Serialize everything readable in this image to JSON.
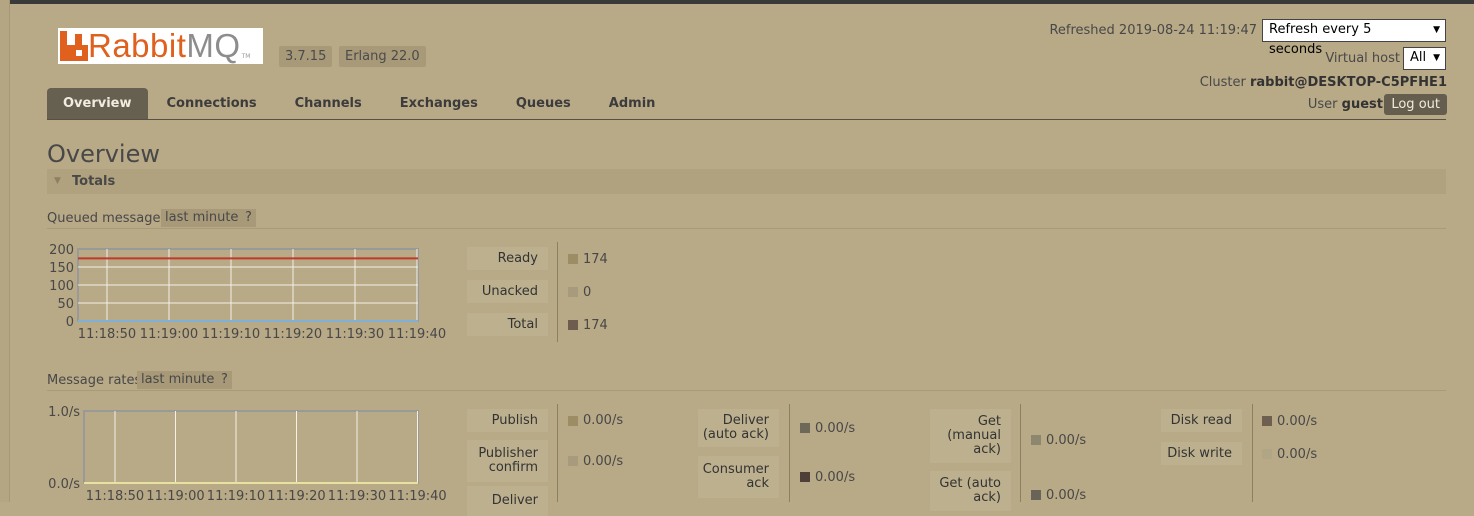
{
  "app": {
    "logo": {
      "brand_r": "Rabbit",
      "brand_m": "MQ",
      "tm": "TM"
    },
    "version": "3.7.15",
    "erlang": "Erlang 22.0"
  },
  "header": {
    "refreshed": "Refreshed 2019-08-24 11:19:47",
    "refresh_select": "Refresh every 5 seconds",
    "vhost_label": "Virtual host",
    "vhost_select": "All",
    "cluster_label": "Cluster",
    "cluster_name": "rabbit@DESKTOP-C5PFHE1",
    "user_label": "User",
    "user_name": "guest",
    "logout": "Log out"
  },
  "tabs": [
    "Overview",
    "Connections",
    "Channels",
    "Exchanges",
    "Queues",
    "Admin"
  ],
  "page": {
    "title": "Overview",
    "section": "Totals",
    "queued": {
      "label": "Queued messages",
      "range": "last minute",
      "help": "?"
    },
    "rates": {
      "label": "Message rates",
      "range": "last minute",
      "help": "?"
    }
  },
  "queued_legend": [
    {
      "label": "Ready",
      "value": "174",
      "color": "#9c8d64"
    },
    {
      "label": "Unacked",
      "value": "0",
      "color": "#a89b7d"
    },
    {
      "label": "Total",
      "value": "174",
      "color": "#6e5d4e"
    }
  ],
  "rates_legend": {
    "col1": [
      {
        "label": "Publish",
        "value": "0.00/s",
        "color": "#9c8d64"
      },
      {
        "label": "Publisher confirm",
        "value": "0.00/s",
        "color": "#a89b7d"
      },
      {
        "label": "Deliver",
        "value": "",
        "color": ""
      }
    ],
    "col2": [
      {
        "label": "Deliver (auto ack)",
        "value": "0.00/s",
        "color": "#6e6858"
      },
      {
        "label": "Consumer ack",
        "value": "0.00/s",
        "color": "#4e4038"
      }
    ],
    "col3": [
      {
        "label": "Get (manual ack)",
        "value": "0.00/s",
        "color": "#8e8770"
      },
      {
        "label": "Get (auto ack)",
        "value": "0.00/s",
        "color": "#6a6357"
      }
    ],
    "col4": [
      {
        "label": "Disk read",
        "value": "0.00/s",
        "color": "#6e6050"
      },
      {
        "label": "Disk write",
        "value": "0.00/s",
        "color": "#b0a584"
      }
    ]
  },
  "chart_data": [
    {
      "type": "line",
      "x": [
        "11:18:50",
        "11:19:00",
        "11:19:10",
        "11:19:20",
        "11:19:30",
        "11:19:40"
      ],
      "ylim": [
        0,
        200
      ],
      "yticks": [
        "200",
        "150",
        "100",
        "50",
        "0"
      ],
      "series": [
        {
          "name": "Ready",
          "values": [
            174,
            174,
            174,
            174,
            174,
            174
          ],
          "color": "#c0392b"
        },
        {
          "name": "Unacked",
          "values": [
            0,
            0,
            0,
            0,
            0,
            0
          ],
          "color": "#7fb0d8"
        }
      ],
      "grid": true
    },
    {
      "type": "line",
      "x": [
        "11:18:50",
        "11:19:00",
        "11:19:10",
        "11:19:20",
        "11:19:30",
        "11:19:40"
      ],
      "ylim": [
        0,
        1
      ],
      "yticks": [
        "1.0/s",
        "0.0/s"
      ],
      "series": [
        {
          "name": "Publish",
          "values": [
            0,
            0,
            0,
            0,
            0,
            0
          ],
          "color": "#e8e2a0"
        }
      ],
      "grid": true
    }
  ]
}
